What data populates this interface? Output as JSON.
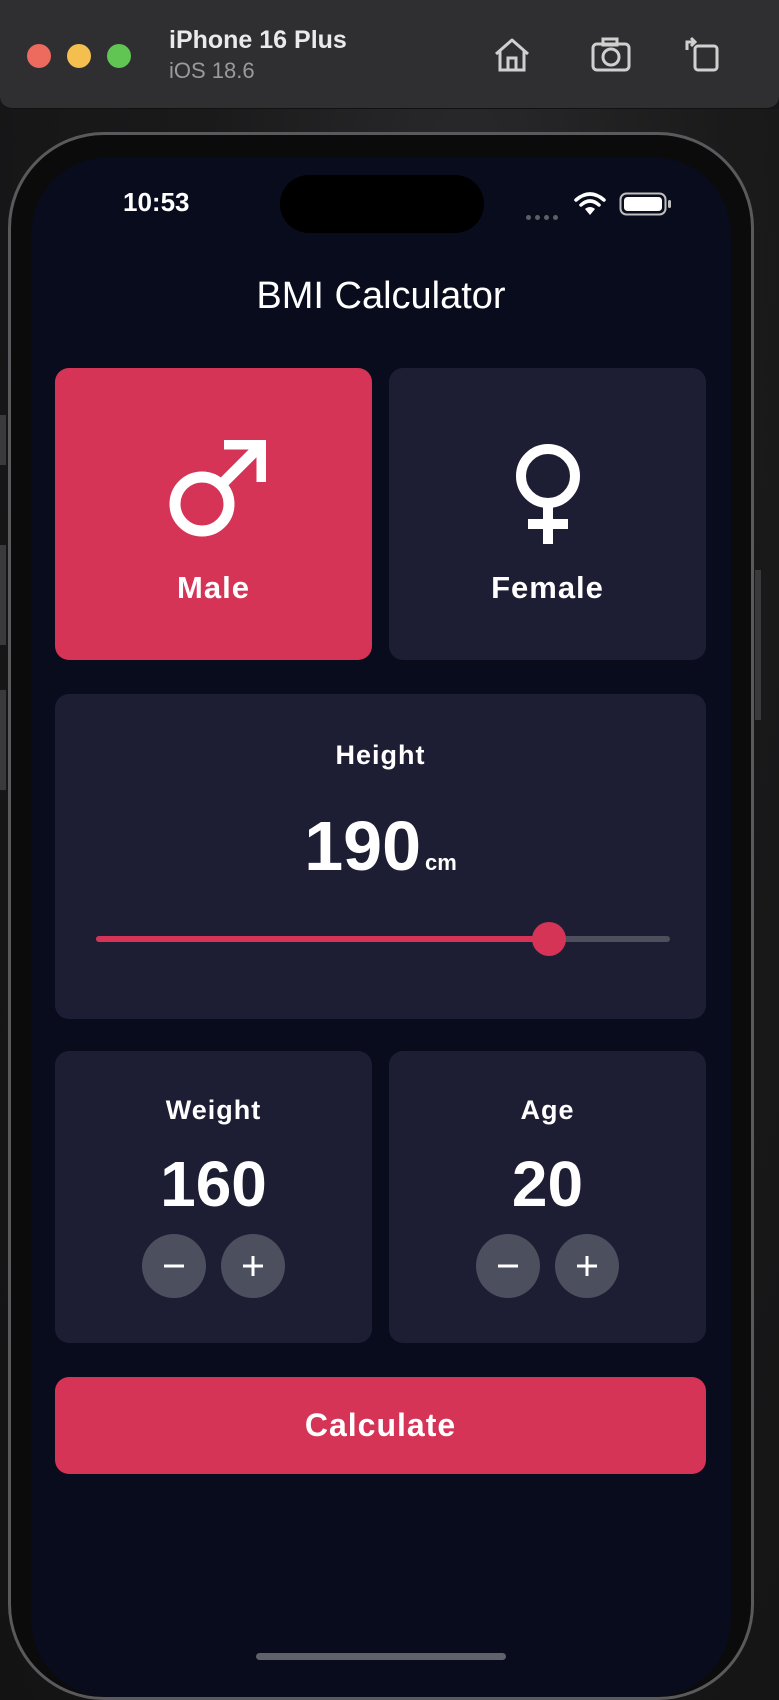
{
  "simulator": {
    "device_name": "iPhone 16 Plus",
    "os_version": "iOS 18.6",
    "icons": [
      "home-icon",
      "screenshot-icon",
      "rotate-icon"
    ]
  },
  "status_bar": {
    "time": "10:53",
    "icons": [
      "wifi-icon",
      "battery-icon"
    ]
  },
  "app": {
    "title": "BMI Calculator",
    "gender": {
      "selected": "male",
      "male_label": "Male",
      "female_label": "Female"
    },
    "height": {
      "label": "Height",
      "value": "190",
      "unit": "cm",
      "slider_fraction": 0.79
    },
    "weight": {
      "label": "Weight",
      "value": "160"
    },
    "age": {
      "label": "Age",
      "value": "20"
    },
    "calculate_label": "Calculate"
  },
  "colors": {
    "background": "#090c1c",
    "card": "#1d1e33",
    "accent": "#d63456",
    "button_round": "#4c4f5e",
    "text": "#ffffff"
  }
}
